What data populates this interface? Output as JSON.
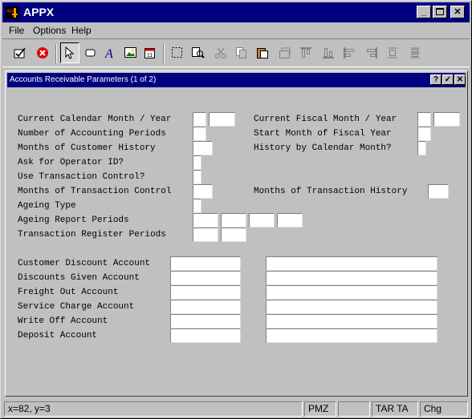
{
  "window": {
    "title": "APPX"
  },
  "menu": {
    "file": "File",
    "options": "Options",
    "help": "Help"
  },
  "toolbar": {
    "icons": [
      "checkbox-edit-icon",
      "cancel-icon",
      "pointer-icon",
      "rectangle-icon",
      "text-a-icon",
      "image-icon",
      "calendar-icon",
      "select-box-icon",
      "find-icon",
      "cut-icon",
      "copy-icon",
      "paste-icon",
      "properties-icon",
      "align-top-icon",
      "align-bottom-icon",
      "align-left-icon",
      "align-right-icon",
      "distribute-h-icon",
      "distribute-v-icon"
    ]
  },
  "form": {
    "title": "Accounts Receivable Parameters (1 of 2)",
    "labels": {
      "cal_month_year": "Current Calendar Month / Year",
      "num_periods": "Number of Accounting Periods",
      "cust_history": "Months of Customer History",
      "ask_operator": "Ask for Operator ID?",
      "use_txn_control": "Use Transaction Control?",
      "txn_control_months": "Months of Transaction Control",
      "ageing_type": "Ageing Type",
      "ageing_periods": "Ageing Report Periods",
      "txn_register_periods": "Transaction Register Periods",
      "fiscal_month_year": "Current Fiscal Month / Year",
      "start_fiscal": "Start Month of Fiscal Year",
      "history_by_cal": "History by Calendar Month?",
      "txn_history_months": "Months of Transaction History",
      "cust_discount": "Customer Discount Account",
      "discounts_given": "Discounts Given Account",
      "freight_out": "Freight Out Account",
      "service_charge": "Service Charge Account",
      "write_off": "Write Off Account",
      "deposit": "Deposit Account"
    }
  },
  "status": {
    "coords": "x=82, y=3",
    "mode": "PMZ",
    "empty": "",
    "tarta": "TAR TA",
    "chg": "Chg"
  }
}
